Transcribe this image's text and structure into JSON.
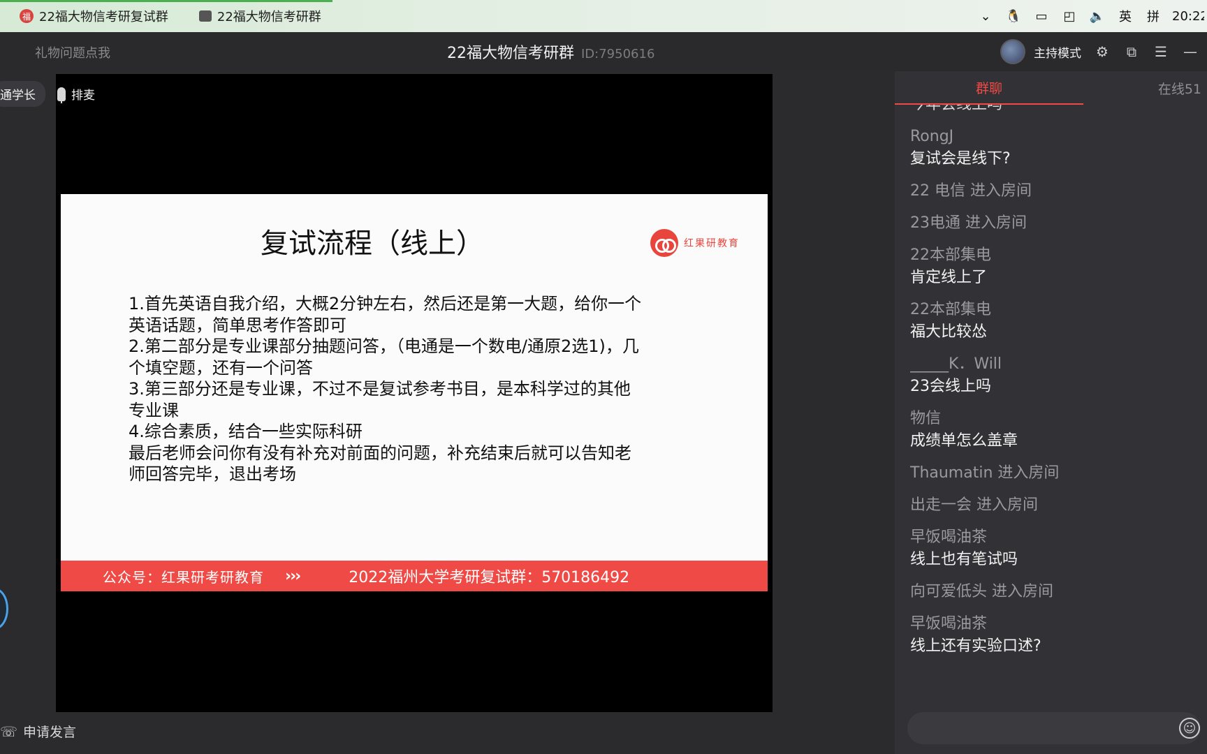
{
  "taskbar": {
    "tabs": [
      {
        "label": "22福大物信考研复试群",
        "icon": "red-seal-icon"
      },
      {
        "label": "22福大物信考研群",
        "icon": "window-icon"
      }
    ],
    "tray": {
      "ime_lang": "英",
      "ime_mode": "拼",
      "clock": "20:22"
    }
  },
  "header": {
    "gift_link": "礼物问题点我",
    "room_name": "22福大物信考研群",
    "room_id": "ID:7950616",
    "host_mode": "主持模式"
  },
  "stage": {
    "speaker_name": "通学长",
    "queue_label": "排麦",
    "apply_speak": "申请发言"
  },
  "slide": {
    "title": "复试流程（线上）",
    "brand": "红果研教育",
    "lines": [
      "1.首先英语自我介绍，大概2分钟左右，然后还是第一大题，给你一个",
      "英语话题，简单思考作答即可",
      "2.第二部分是专业课部分抽题问答，（电通是一个数电/通原2选1)，几",
      "个填空题，还有一个问答",
      "3.第三部分还是专业课，不过不是复试参考书目，是本科学过的其他",
      "专业课",
      "4.综合素质，结合一些实际科研",
      "最后老师会问你有没有补充对前面的问题，补充结束后就可以告知老",
      "师回答完毕，退出考场"
    ],
    "footer_left": "公众号：红果研考研教育",
    "footer_arrows": "›››",
    "footer_right": "2022福州大学考研复试群：570186492"
  },
  "chat": {
    "tab_group": "群聊",
    "tab_online": "在线51",
    "clipped_text": "今年会线上吗",
    "messages": [
      {
        "name": "RongJ",
        "text": "复试会是线下?"
      },
      {
        "name": "22 电信 进入房间",
        "text": ""
      },
      {
        "name": "23电通 进入房间",
        "text": ""
      },
      {
        "name": "22本部集电",
        "text": "肯定线上了"
      },
      {
        "name": "22本部集电",
        "text": "福大比较怂"
      },
      {
        "name": "_____K．Will",
        "text": "23会线上吗"
      },
      {
        "name": "物信",
        "text": "成绩单怎么盖章"
      },
      {
        "name": "Thaumatin 进入房间",
        "text": ""
      },
      {
        "name": "出走一会 进入房间",
        "text": ""
      },
      {
        "name": "早饭喝油茶",
        "text": "线上也有笔试吗"
      },
      {
        "name": "向可爱低头 进入房间",
        "text": ""
      },
      {
        "name": "早饭喝油茶",
        "text": "线上还有实验口述?"
      }
    ],
    "input_placeholder": ""
  }
}
